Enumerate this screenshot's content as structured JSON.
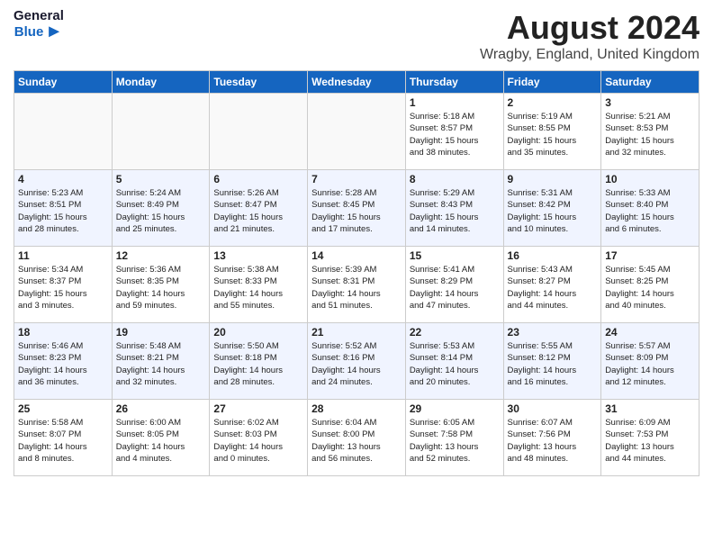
{
  "header": {
    "logo_general": "General",
    "logo_blue": "Blue",
    "month_year": "August 2024",
    "location": "Wragby, England, United Kingdom"
  },
  "days_of_week": [
    "Sunday",
    "Monday",
    "Tuesday",
    "Wednesday",
    "Thursday",
    "Friday",
    "Saturday"
  ],
  "weeks": [
    [
      {
        "day": "",
        "info": ""
      },
      {
        "day": "",
        "info": ""
      },
      {
        "day": "",
        "info": ""
      },
      {
        "day": "",
        "info": ""
      },
      {
        "day": "1",
        "info": "Sunrise: 5:18 AM\nSunset: 8:57 PM\nDaylight: 15 hours\nand 38 minutes."
      },
      {
        "day": "2",
        "info": "Sunrise: 5:19 AM\nSunset: 8:55 PM\nDaylight: 15 hours\nand 35 minutes."
      },
      {
        "day": "3",
        "info": "Sunrise: 5:21 AM\nSunset: 8:53 PM\nDaylight: 15 hours\nand 32 minutes."
      }
    ],
    [
      {
        "day": "4",
        "info": "Sunrise: 5:23 AM\nSunset: 8:51 PM\nDaylight: 15 hours\nand 28 minutes."
      },
      {
        "day": "5",
        "info": "Sunrise: 5:24 AM\nSunset: 8:49 PM\nDaylight: 15 hours\nand 25 minutes."
      },
      {
        "day": "6",
        "info": "Sunrise: 5:26 AM\nSunset: 8:47 PM\nDaylight: 15 hours\nand 21 minutes."
      },
      {
        "day": "7",
        "info": "Sunrise: 5:28 AM\nSunset: 8:45 PM\nDaylight: 15 hours\nand 17 minutes."
      },
      {
        "day": "8",
        "info": "Sunrise: 5:29 AM\nSunset: 8:43 PM\nDaylight: 15 hours\nand 14 minutes."
      },
      {
        "day": "9",
        "info": "Sunrise: 5:31 AM\nSunset: 8:42 PM\nDaylight: 15 hours\nand 10 minutes."
      },
      {
        "day": "10",
        "info": "Sunrise: 5:33 AM\nSunset: 8:40 PM\nDaylight: 15 hours\nand 6 minutes."
      }
    ],
    [
      {
        "day": "11",
        "info": "Sunrise: 5:34 AM\nSunset: 8:37 PM\nDaylight: 15 hours\nand 3 minutes."
      },
      {
        "day": "12",
        "info": "Sunrise: 5:36 AM\nSunset: 8:35 PM\nDaylight: 14 hours\nand 59 minutes."
      },
      {
        "day": "13",
        "info": "Sunrise: 5:38 AM\nSunset: 8:33 PM\nDaylight: 14 hours\nand 55 minutes."
      },
      {
        "day": "14",
        "info": "Sunrise: 5:39 AM\nSunset: 8:31 PM\nDaylight: 14 hours\nand 51 minutes."
      },
      {
        "day": "15",
        "info": "Sunrise: 5:41 AM\nSunset: 8:29 PM\nDaylight: 14 hours\nand 47 minutes."
      },
      {
        "day": "16",
        "info": "Sunrise: 5:43 AM\nSunset: 8:27 PM\nDaylight: 14 hours\nand 44 minutes."
      },
      {
        "day": "17",
        "info": "Sunrise: 5:45 AM\nSunset: 8:25 PM\nDaylight: 14 hours\nand 40 minutes."
      }
    ],
    [
      {
        "day": "18",
        "info": "Sunrise: 5:46 AM\nSunset: 8:23 PM\nDaylight: 14 hours\nand 36 minutes."
      },
      {
        "day": "19",
        "info": "Sunrise: 5:48 AM\nSunset: 8:21 PM\nDaylight: 14 hours\nand 32 minutes."
      },
      {
        "day": "20",
        "info": "Sunrise: 5:50 AM\nSunset: 8:18 PM\nDaylight: 14 hours\nand 28 minutes."
      },
      {
        "day": "21",
        "info": "Sunrise: 5:52 AM\nSunset: 8:16 PM\nDaylight: 14 hours\nand 24 minutes."
      },
      {
        "day": "22",
        "info": "Sunrise: 5:53 AM\nSunset: 8:14 PM\nDaylight: 14 hours\nand 20 minutes."
      },
      {
        "day": "23",
        "info": "Sunrise: 5:55 AM\nSunset: 8:12 PM\nDaylight: 14 hours\nand 16 minutes."
      },
      {
        "day": "24",
        "info": "Sunrise: 5:57 AM\nSunset: 8:09 PM\nDaylight: 14 hours\nand 12 minutes."
      }
    ],
    [
      {
        "day": "25",
        "info": "Sunrise: 5:58 AM\nSunset: 8:07 PM\nDaylight: 14 hours\nand 8 minutes."
      },
      {
        "day": "26",
        "info": "Sunrise: 6:00 AM\nSunset: 8:05 PM\nDaylight: 14 hours\nand 4 minutes."
      },
      {
        "day": "27",
        "info": "Sunrise: 6:02 AM\nSunset: 8:03 PM\nDaylight: 14 hours\nand 0 minutes."
      },
      {
        "day": "28",
        "info": "Sunrise: 6:04 AM\nSunset: 8:00 PM\nDaylight: 13 hours\nand 56 minutes."
      },
      {
        "day": "29",
        "info": "Sunrise: 6:05 AM\nSunset: 7:58 PM\nDaylight: 13 hours\nand 52 minutes."
      },
      {
        "day": "30",
        "info": "Sunrise: 6:07 AM\nSunset: 7:56 PM\nDaylight: 13 hours\nand 48 minutes."
      },
      {
        "day": "31",
        "info": "Sunrise: 6:09 AM\nSunset: 7:53 PM\nDaylight: 13 hours\nand 44 minutes."
      }
    ]
  ]
}
